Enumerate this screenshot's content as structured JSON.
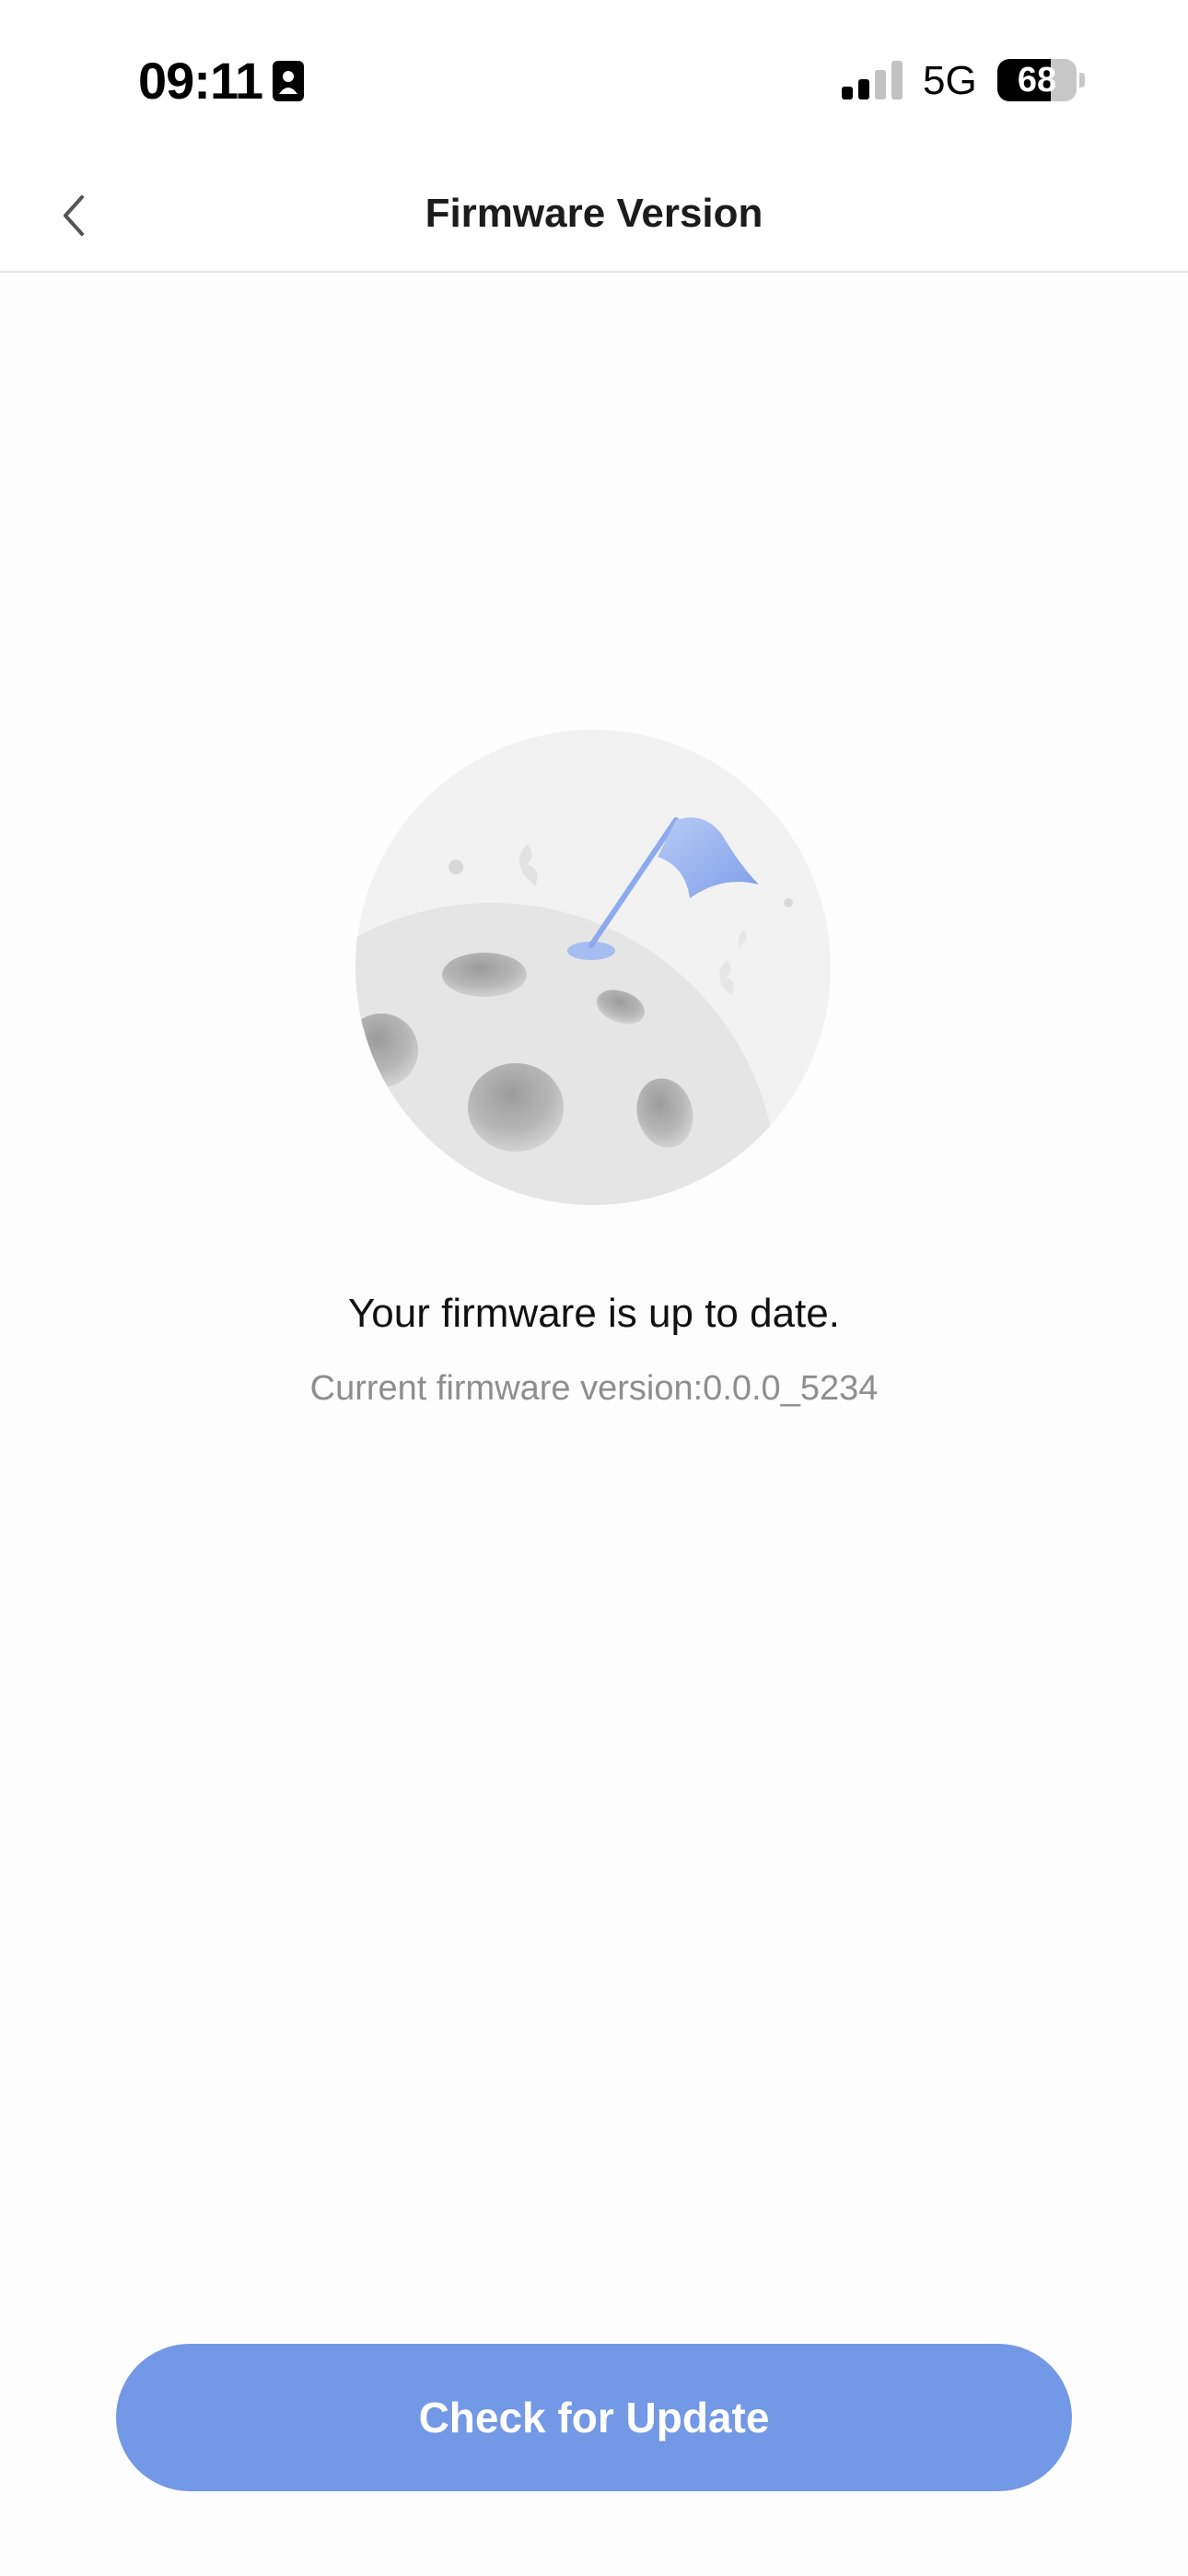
{
  "status_bar": {
    "time": "09:11",
    "network": "5G",
    "battery_level": "68",
    "battery_fraction": 0.68,
    "icons": [
      "contact-card-icon",
      "signal-icon",
      "battery-icon"
    ]
  },
  "nav": {
    "title": "Firmware Version",
    "back_icon": "chevron-left-icon"
  },
  "content": {
    "illustration": "moon-flag-illustration",
    "message": "Your firmware is up to date.",
    "version_text": "Current firmware version:0.0.0_5234"
  },
  "actions": {
    "check_update_label": "Check for Update"
  },
  "colors": {
    "accent": "#7398e5",
    "flag": "#9cb6ee"
  }
}
